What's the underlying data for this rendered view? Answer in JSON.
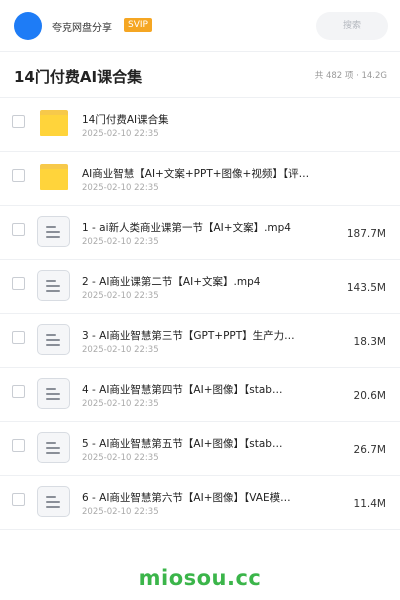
{
  "header": {
    "share_name": "夸克网盘分享",
    "badge": "SVIP",
    "search_placeholder": "搜索",
    "avatar_color": "#1e7cf6"
  },
  "folder": {
    "title": "14门付费AI课合集",
    "meta": "共 482 项 · 14.2G"
  },
  "files": [
    {
      "type": "folder",
      "name": "14门付费AI课合集",
      "date": "2025-02-10 22:35",
      "size": ""
    },
    {
      "type": "folder",
      "name": "AI商业智慧【AI+文案+PPT+图像+视频】【评…",
      "date": "2025-02-10 22:35",
      "size": ""
    },
    {
      "type": "file",
      "name": "1 - ai新人类商业课第一节【AI+文案】.mp4",
      "date": "2025-02-10 22:35",
      "size": "187.7M"
    },
    {
      "type": "file",
      "name": "2 - AI商业课第二节【AI+文案】.mp4",
      "date": "2025-02-10 22:35",
      "size": "143.5M"
    },
    {
      "type": "file",
      "name": "3 - AI商业智慧第三节【GPT+PPT】生产力…",
      "date": "2025-02-10 22:35",
      "size": "18.3M"
    },
    {
      "type": "file",
      "name": "4 - AI商业智慧第四节【AI+图像】【stab…",
      "date": "2025-02-10 22:35",
      "size": "20.6M"
    },
    {
      "type": "file",
      "name": "5 - AI商业智慧第五节【AI+图像】【stab…",
      "date": "2025-02-10 22:35",
      "size": "26.7M"
    },
    {
      "type": "file",
      "name": "6 - AI商业智慧第六节【AI+图像】【VAE模…",
      "date": "2025-02-10 22:35",
      "size": "11.4M"
    }
  ],
  "watermark": "miosou.cc",
  "colors": {
    "folder": "#ffd43b",
    "badge": "#f5a623",
    "watermark": "#3bb54a"
  }
}
